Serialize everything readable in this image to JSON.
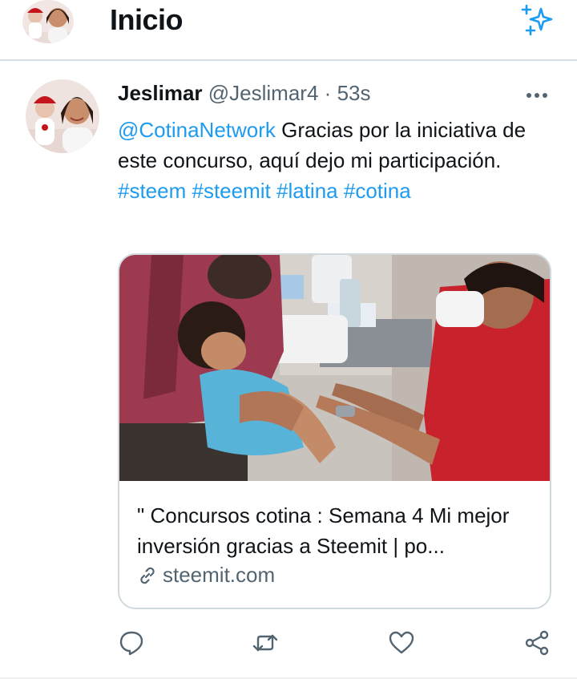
{
  "header": {
    "title": "Inicio",
    "avatar_icon": "profile-photo",
    "sparkle_icon": "sparkle-icon",
    "accent_color": "#1d9bf0"
  },
  "tweet": {
    "author_name": "Jeslimar",
    "author_handle": "@Jeslimar4",
    "separator": "·",
    "time": "53s",
    "text": {
      "mention": "@CotinaNetwork",
      "body": " Gracias por la iniciativa de este concurso, aquí dejo mi participación.",
      "hashtags": [
        "#steem",
        "#steemit",
        "#latina",
        "#cotina"
      ]
    },
    "more_icon": "more-options-icon"
  },
  "card": {
    "image_icon": "vaccination-photo",
    "title": "\" Concursos cotina : Semana 4 Mi mejor inversión gracias a Steemit | po...",
    "domain": "steemit.com",
    "domain_icon": "link-icon"
  },
  "actions": [
    {
      "name": "reply",
      "icon": "reply-icon"
    },
    {
      "name": "retweet",
      "icon": "retweet-icon"
    },
    {
      "name": "like",
      "icon": "heart-icon"
    },
    {
      "name": "share",
      "icon": "share-icon"
    }
  ],
  "colors": {
    "text_primary": "#0f1419",
    "text_secondary": "#536471",
    "link": "#1d9bf0",
    "border": "#cfd9de"
  }
}
